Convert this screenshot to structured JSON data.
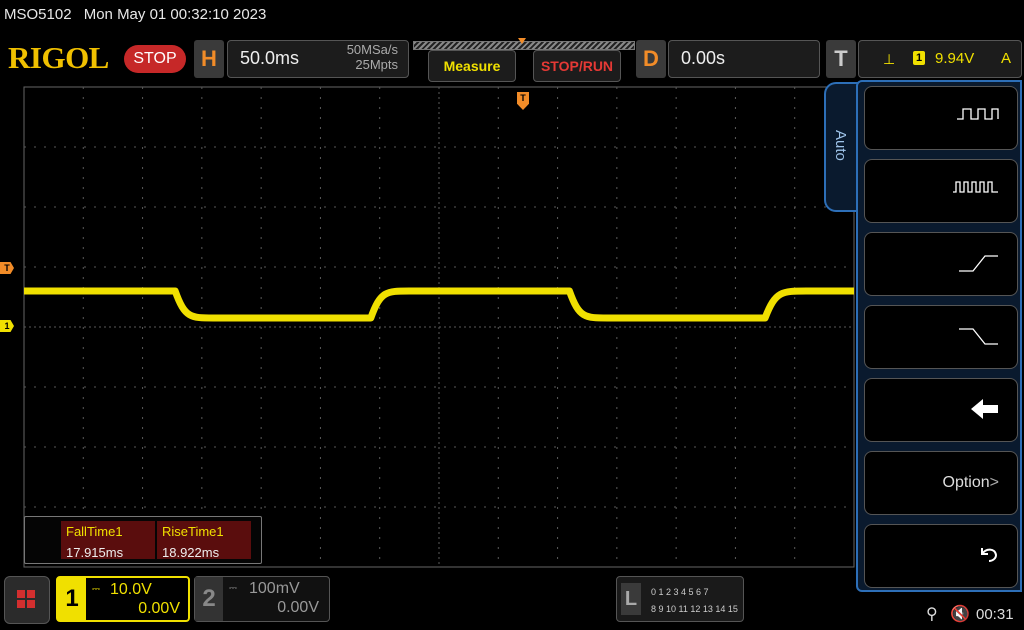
{
  "title_bar": {
    "model": "MSO5102",
    "datetime": "Mon May 01 00:32:10 2023"
  },
  "brand": "RIGOL",
  "run_state": "STOP",
  "horizontal": {
    "letter": "H",
    "scale": "50.0ms",
    "sample_rate": "50MSa/s",
    "memory_depth": "25Mpts"
  },
  "buttons": {
    "measure": "Measure",
    "stop_run": "STOP/RUN"
  },
  "delay": {
    "letter": "D",
    "value": "0.00s"
  },
  "trigger": {
    "letter": "T",
    "source": "1",
    "level": "9.94V",
    "mode": "A",
    "edge_symbol": "⊥"
  },
  "markers": {
    "trigger_level": "T",
    "ch1_offset": "1",
    "trigger_position": "T"
  },
  "colors": {
    "ch1": "#f0e000",
    "trigger": "#f28c28",
    "grid": "#5a5a5a",
    "menu_border": "#2d6fb8",
    "stop": "#c62828"
  },
  "waveform": {
    "channel": 1,
    "high_level_div": 0.6,
    "low_level_div": 0.15,
    "segments": [
      {
        "t_div": 0.0,
        "level": "high"
      },
      {
        "t_div": 2.55,
        "level": "high"
      },
      {
        "t_div": 3.2,
        "level": "low"
      },
      {
        "t_div": 5.85,
        "level": "low"
      },
      {
        "t_div": 6.5,
        "level": "high"
      },
      {
        "t_div": 9.2,
        "level": "high"
      },
      {
        "t_div": 9.85,
        "level": "low"
      },
      {
        "t_div": 12.5,
        "level": "low"
      },
      {
        "t_div": 13.2,
        "level": "high"
      },
      {
        "t_div": 14.0,
        "level": "high"
      }
    ]
  },
  "measurements": [
    {
      "label": "FallTime1",
      "value": "17.915ms"
    },
    {
      "label": "RiseTime1",
      "value": "18.922ms"
    }
  ],
  "menu": {
    "tab_label": "Auto",
    "softkeys": [
      {
        "icon": "multi-period-icon"
      },
      {
        "icon": "single-period-icon"
      },
      {
        "icon": "rising-edge-icon"
      },
      {
        "icon": "falling-edge-icon"
      },
      {
        "icon": "undo-arrow-icon"
      },
      {
        "label": "Option"
      },
      {
        "icon": "back-icon"
      }
    ]
  },
  "channels": [
    {
      "number": "1",
      "coupling": "DC",
      "scale": "10.0V",
      "offset": "0.00V",
      "active": true
    },
    {
      "number": "2",
      "coupling": "DC",
      "scale": "100mV",
      "offset": "0.00V",
      "active": false
    }
  ],
  "logic": {
    "letter": "L",
    "row1": "0 1 2 3   4 5 6 7",
    "row2": "8 9 10 11 12 13 14 15"
  },
  "status": {
    "clock": "00:31"
  }
}
